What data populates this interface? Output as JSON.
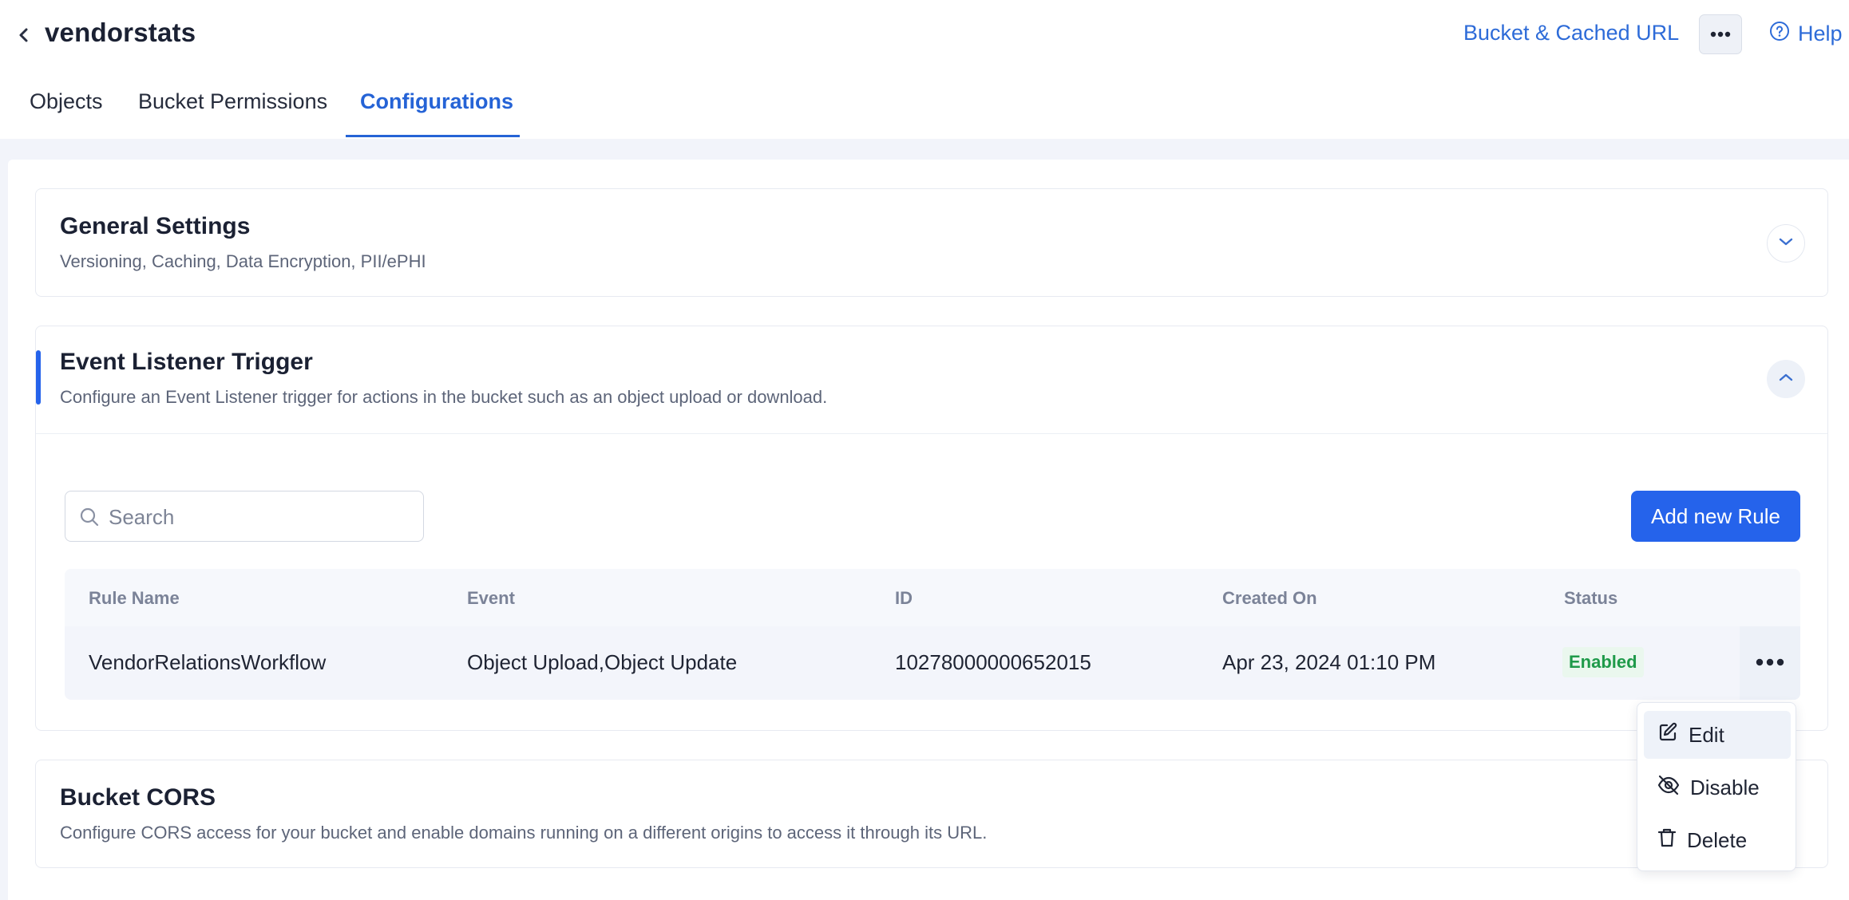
{
  "header": {
    "bucket_name": "vendorstats",
    "bucket_url_link": "Bucket & Cached URL",
    "help_label": "Help",
    "icons": [
      "chevron-left-icon",
      "more-horizontal-icon",
      "help-circle-icon"
    ]
  },
  "tabs": [
    {
      "label": "Objects",
      "active": false
    },
    {
      "label": "Bucket Permissions",
      "active": false
    },
    {
      "label": "Configurations",
      "active": true
    }
  ],
  "sections": {
    "general": {
      "title": "General Settings",
      "description": "Versioning, Caching, Data Encryption, PII/ePHI",
      "expanded": false
    },
    "event_listener": {
      "title": "Event Listener Trigger",
      "description": "Configure an Event Listener trigger for actions in the bucket such as an object upload or download.",
      "expanded": true
    },
    "cors": {
      "title": "Bucket CORS",
      "description": "Configure CORS access for your bucket and enable domains running on a different origins to access it through its URL."
    }
  },
  "search": {
    "placeholder": "Search",
    "value": ""
  },
  "add_rule_label": "Add new Rule",
  "table": {
    "columns": [
      "Rule Name",
      "Event",
      "ID",
      "Created On",
      "Status"
    ],
    "rows": [
      {
        "rule_name": "VendorRelationsWorkflow",
        "event": "Object Upload,Object Update",
        "id": "10278000000652015",
        "created_on": "Apr 23, 2024 01:10 PM",
        "status": "Enabled"
      }
    ]
  },
  "row_menu": {
    "items": [
      {
        "label": "Edit",
        "icon": "edit-icon"
      },
      {
        "label": "Disable",
        "icon": "eye-off-icon"
      },
      {
        "label": "Delete",
        "icon": "trash-icon"
      }
    ]
  },
  "colors": {
    "accent": "#2563eb",
    "link": "#2d6bd8",
    "status_enabled": "#1f9a4a",
    "page_bg": "#f2f4fa"
  }
}
